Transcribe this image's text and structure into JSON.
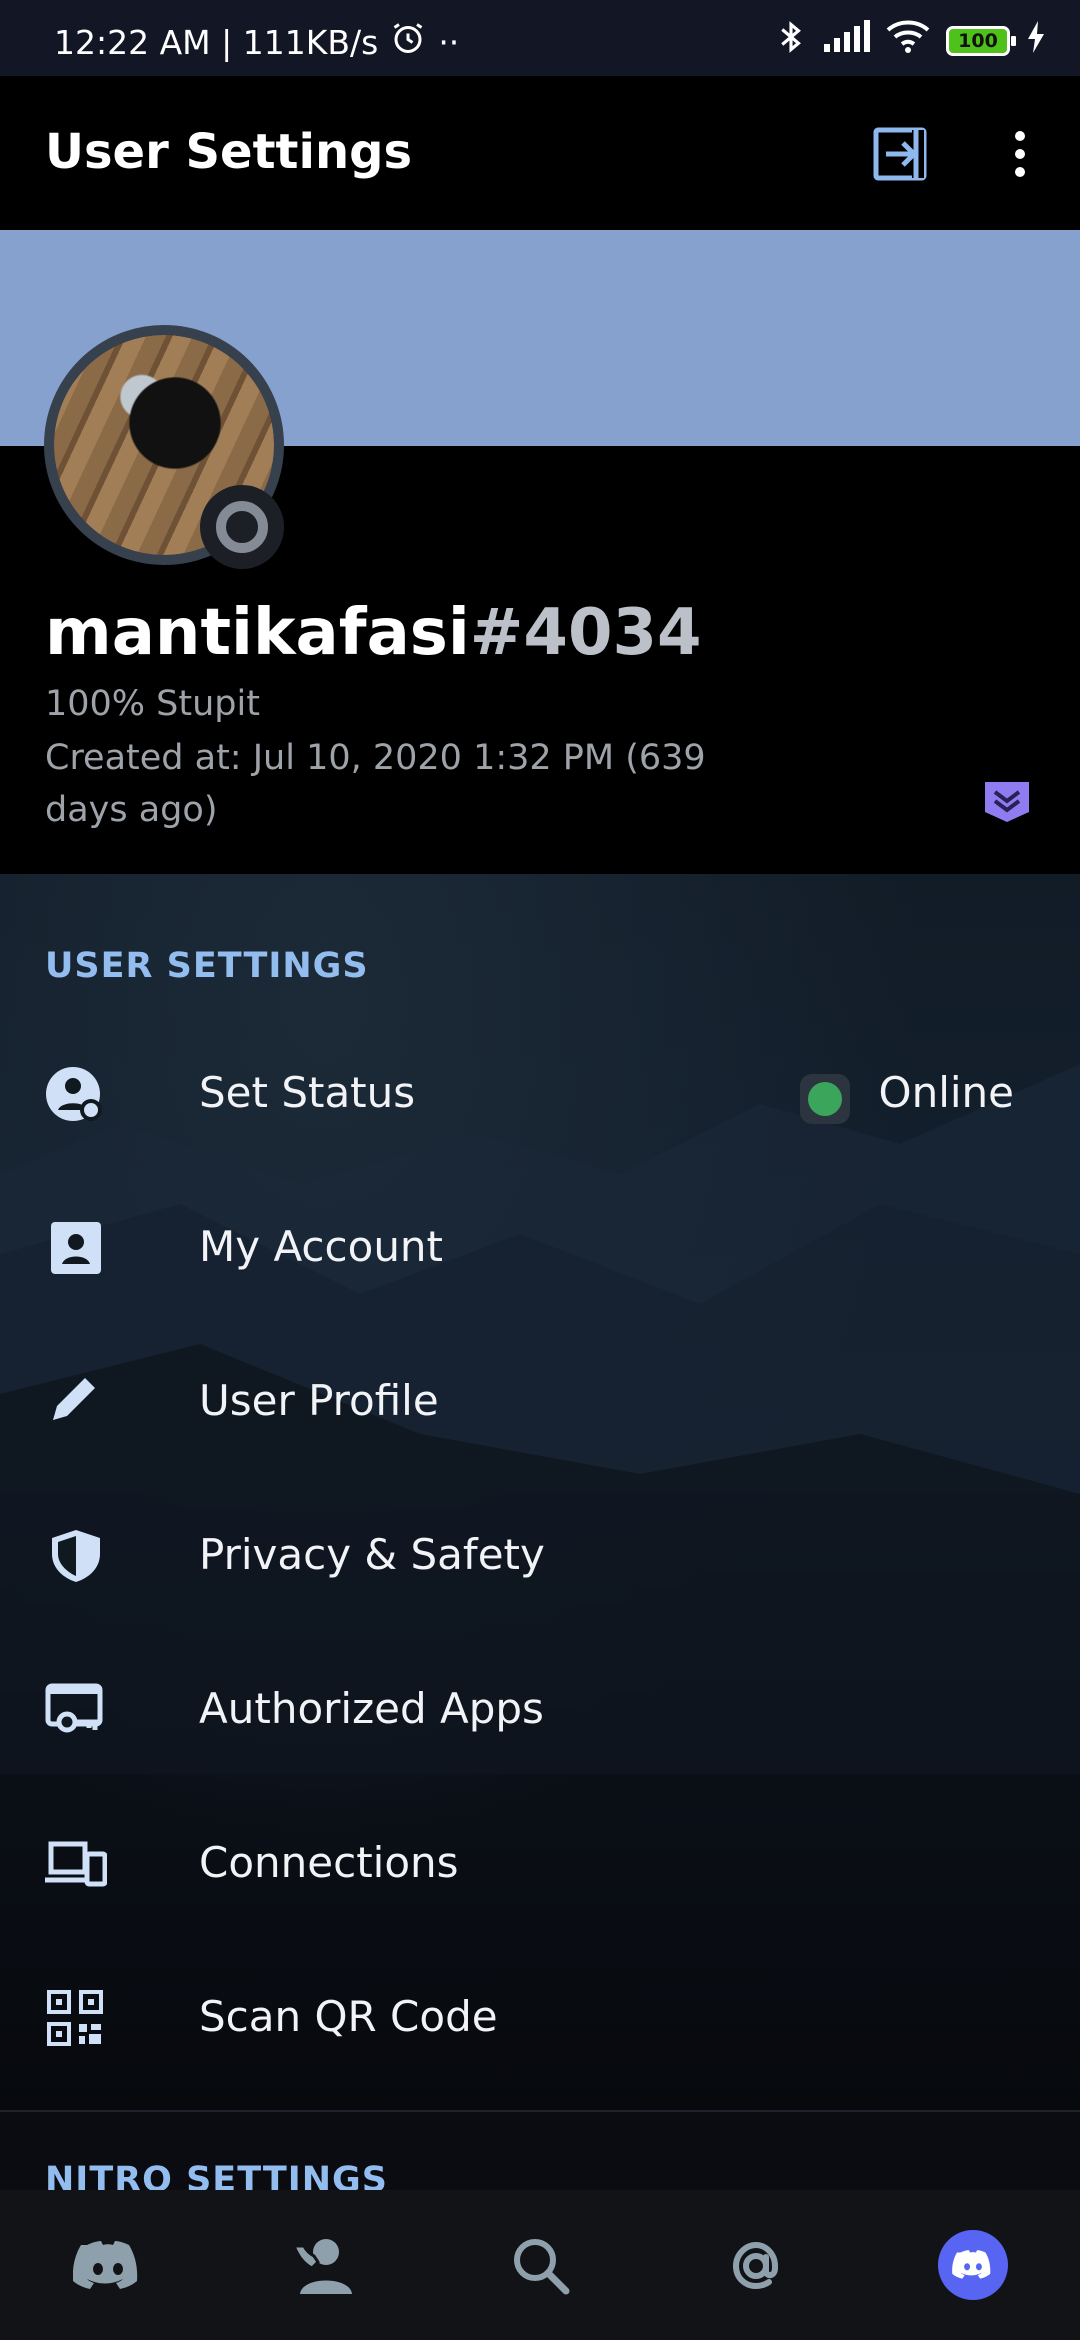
{
  "status_bar": {
    "time_speed": "12:22 AM | 111KB/s",
    "dots": "··",
    "battery": "100"
  },
  "header": {
    "title": "User Settings"
  },
  "profile": {
    "username": "mantikafasi",
    "discriminator": "#4034",
    "bio": "100% Stupit",
    "created": "Created at: Jul 10, 2020 1:32 PM (639 days ago)"
  },
  "sections": {
    "user_settings": "USER SETTINGS",
    "nitro_settings": "NITRO SETTINGS"
  },
  "items": [
    {
      "label": "Set Status",
      "value": "Online",
      "icon": "status-icon"
    },
    {
      "label": "My Account",
      "icon": "account-icon"
    },
    {
      "label": "User Profile",
      "icon": "pencil-icon"
    },
    {
      "label": "Privacy & Safety",
      "icon": "shield-icon"
    },
    {
      "label": "Authorized Apps",
      "icon": "authorized-apps-icon"
    },
    {
      "label": "Connections",
      "icon": "devices-icon"
    },
    {
      "label": "Scan QR Code",
      "icon": "qr-code-icon"
    }
  ],
  "colors": {
    "banner": "#86a1ce",
    "accent_text": "#93bcef",
    "online": "#3ba55c",
    "blurple": "#5865f2"
  },
  "bottom_nav": [
    "home-icon",
    "friends-icon",
    "search-icon",
    "mentions-icon",
    "profile-icon"
  ]
}
